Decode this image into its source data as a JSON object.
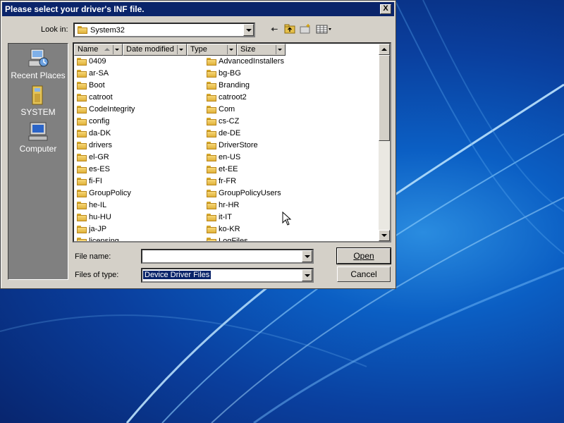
{
  "dialog": {
    "title": "Please select your driver's INF file.",
    "close_label": "X"
  },
  "lookin": {
    "label": "Look in:",
    "value": "System32"
  },
  "toolbar": {
    "back_icon": "back-arrow-icon",
    "up_icon": "up-folder-icon",
    "new_folder_icon": "new-folder-icon",
    "views_icon": "views-menu-icon"
  },
  "places": [
    {
      "label": "Recent Places",
      "icon": "recent-places-icon"
    },
    {
      "label": "SYSTEM",
      "icon": "user-folder-icon"
    },
    {
      "label": "Computer",
      "icon": "computer-icon"
    }
  ],
  "columns": [
    {
      "label": "Name"
    },
    {
      "label": "Date modified"
    },
    {
      "label": "Type"
    },
    {
      "label": "Size"
    }
  ],
  "folders_col1": [
    "0409",
    "ar-SA",
    "Boot",
    "catroot",
    "CodeIntegrity",
    "config",
    "da-DK",
    "drivers",
    "el-GR",
    "es-ES",
    "fi-FI",
    "GroupPolicy",
    "he-IL",
    "hu-HU",
    "ja-JP",
    "licensing"
  ],
  "folders_col2": [
    "AdvancedInstallers",
    "bg-BG",
    "Branding",
    "catroot2",
    "Com",
    "cs-CZ",
    "de-DE",
    "DriverStore",
    "en-US",
    "et-EE",
    "fr-FR",
    "GroupPolicyUsers",
    "hr-HR",
    "it-IT",
    "ko-KR",
    "LogFiles"
  ],
  "filename": {
    "label": "File name:",
    "value": ""
  },
  "filetype": {
    "label": "Files of type:",
    "value": "Device Driver Files"
  },
  "buttons": {
    "open": "Open",
    "cancel": "Cancel"
  },
  "colors": {
    "titlebar": "#0a246a",
    "dialog_bg": "#d4d0c8",
    "places_bg": "#808080",
    "selection": "#0a246a"
  }
}
